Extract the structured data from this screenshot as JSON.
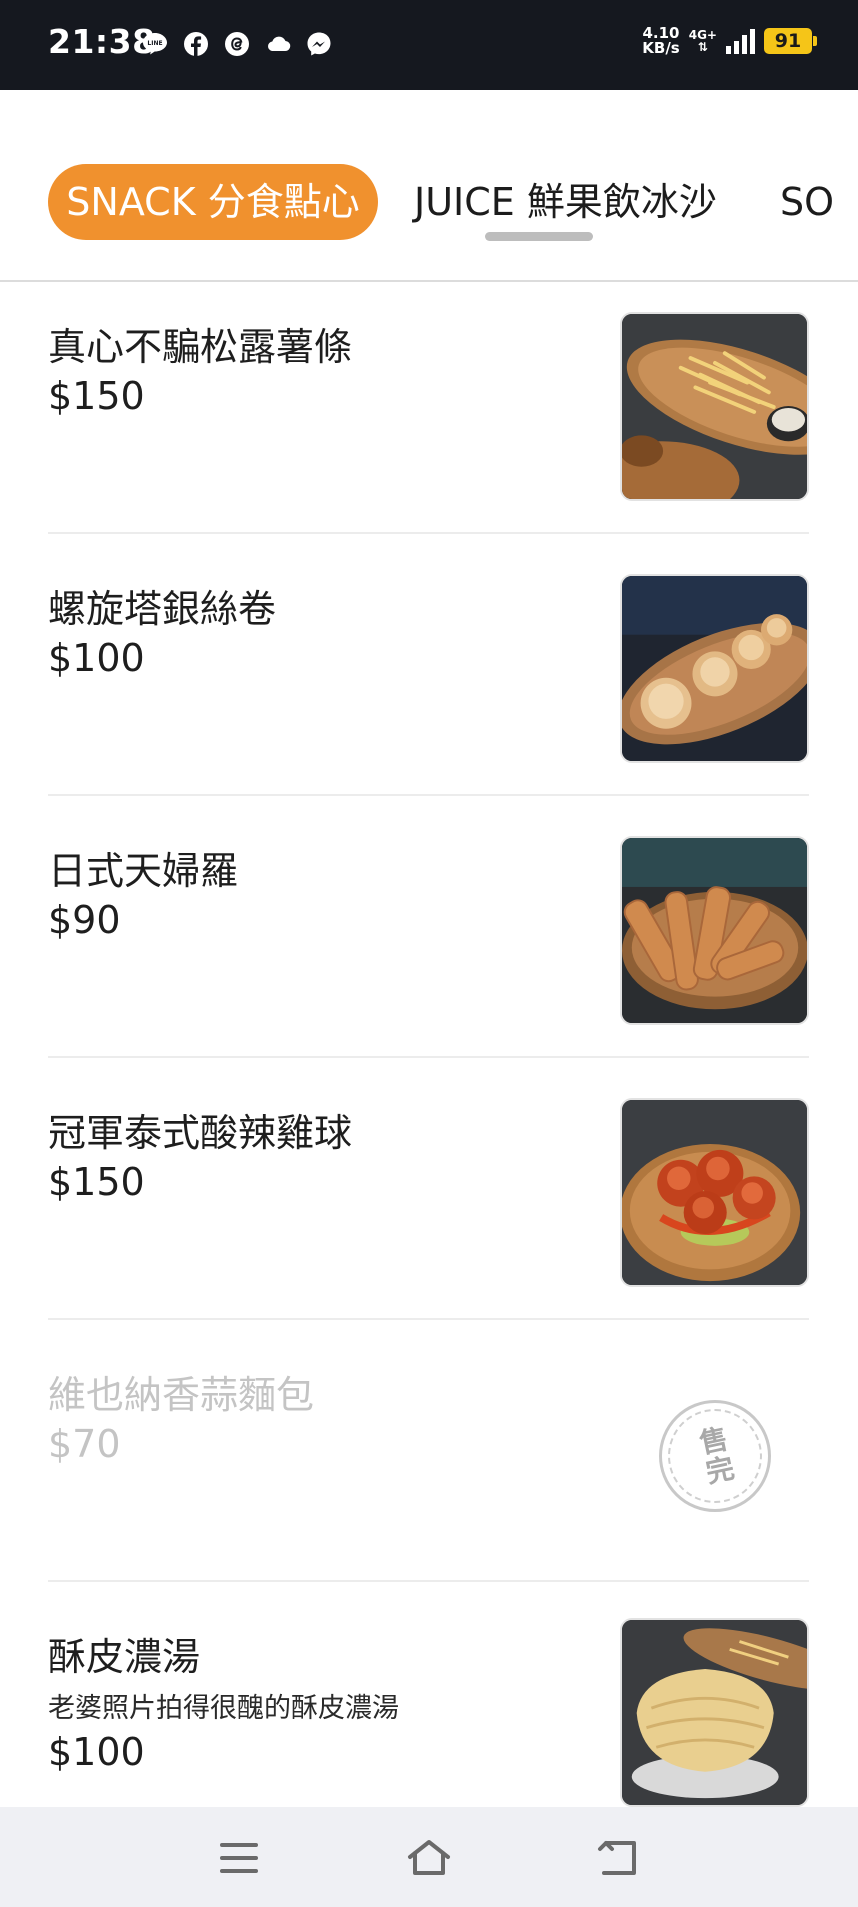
{
  "status_bar": {
    "time": "21:38",
    "apps": [
      "line-icon",
      "facebook-icon",
      "threads-icon",
      "cloud-icon",
      "messenger-icon"
    ],
    "net_speed_value": "4.10",
    "net_speed_unit": "KB/s",
    "network_type": "4G+",
    "battery": "91"
  },
  "tabs": [
    {
      "label": "SNACK 分食點心",
      "active": true
    },
    {
      "label": "JUICE 鮮果飲冰沙",
      "active": false
    },
    {
      "label": "SO",
      "active": false
    }
  ],
  "menu_items": [
    {
      "name": "真心不騙松露薯條",
      "price": "$150",
      "description": "",
      "sold_out": false,
      "photo": "truffle-fries-photo"
    },
    {
      "name": "螺旋塔銀絲卷",
      "price": "$100",
      "description": "",
      "sold_out": false,
      "photo": "spiral-buns-photo"
    },
    {
      "name": "日式天婦羅",
      "price": "$90",
      "description": "",
      "sold_out": false,
      "photo": "tempura-photo"
    },
    {
      "name": "冠軍泰式酸辣雞球",
      "price": "$150",
      "description": "",
      "sold_out": false,
      "photo": "thai-chicken-balls-photo"
    },
    {
      "name": "維也納香蒜麵包",
      "price": "$70",
      "description": "",
      "sold_out": true,
      "sold_out_label": "售完"
    },
    {
      "name": "酥皮濃湯",
      "price": "$100",
      "description": "老婆照片拍得很醜的酥皮濃湯",
      "sold_out": false,
      "photo": "puff-pastry-soup-photo"
    }
  ],
  "colors": {
    "accent": "#f0912e",
    "status_bar_bg": "#15181f",
    "battery": "#f5c518",
    "sold_out_text": "#c4c4c4"
  },
  "nav_bar": {
    "icons": [
      "recents-menu-icon",
      "home-icon",
      "back-icon"
    ]
  }
}
